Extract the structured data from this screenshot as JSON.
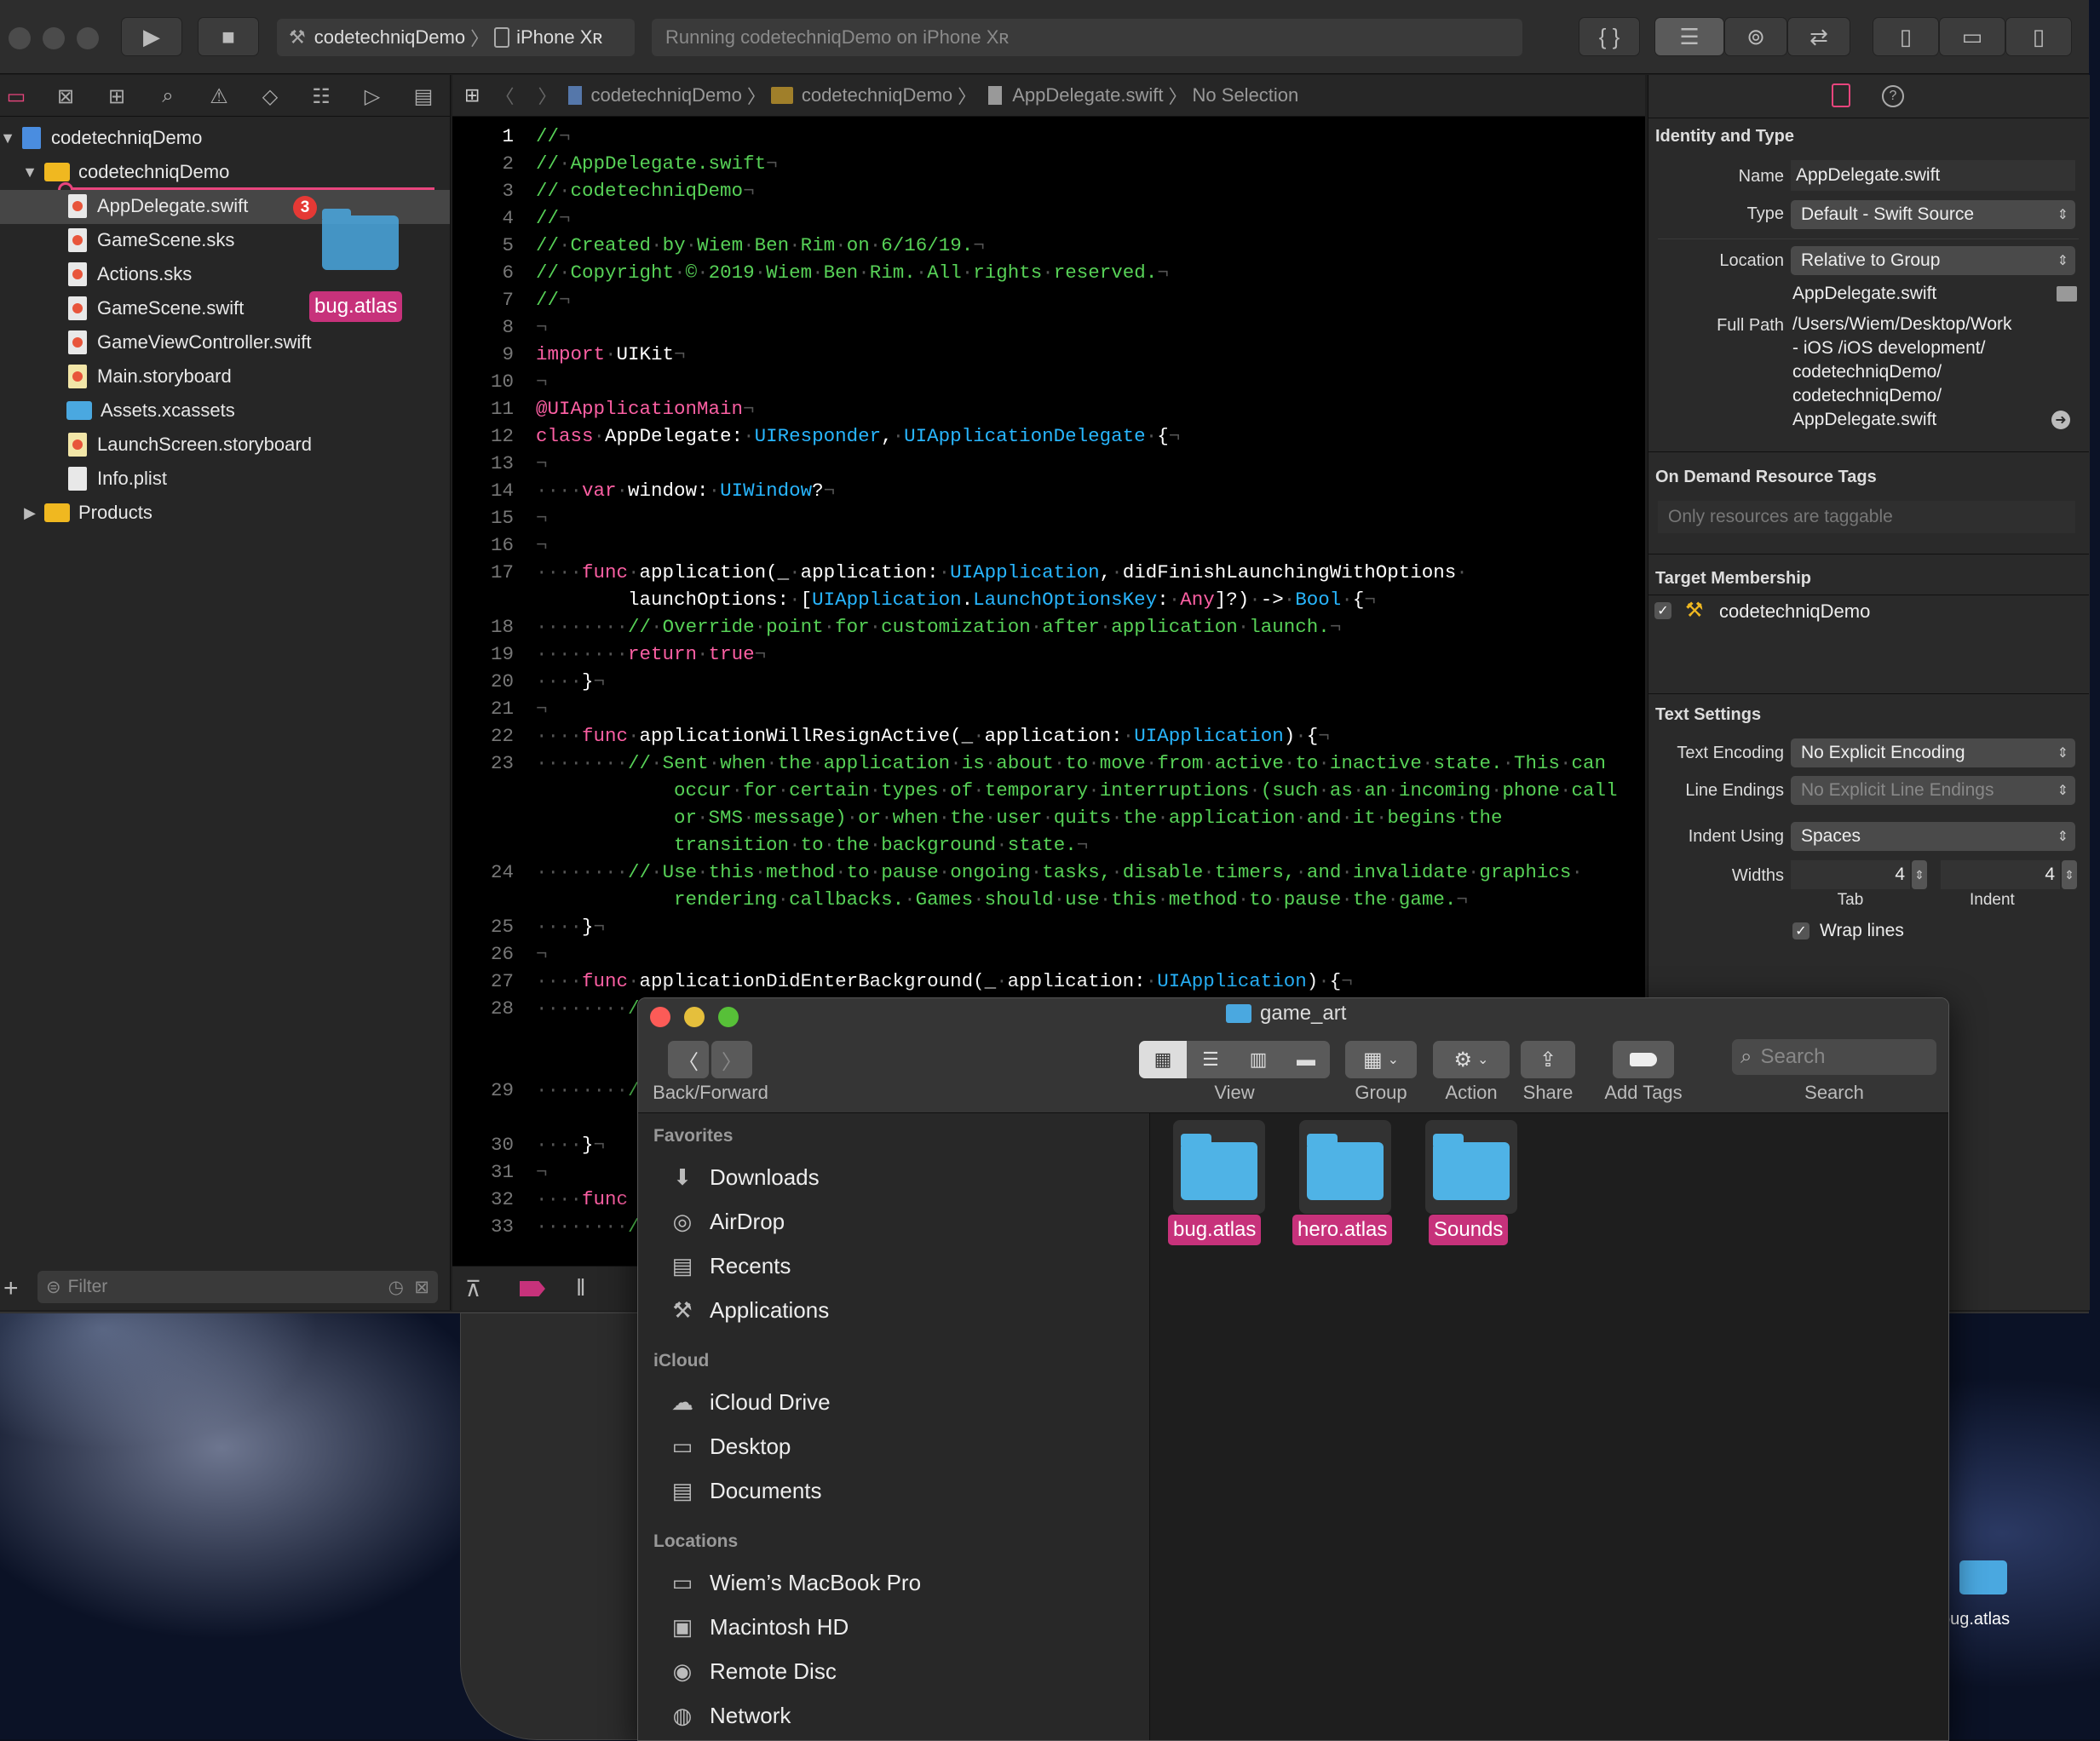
{
  "xcode": {
    "toolbar": {
      "scheme_target": "codetechniqDemo",
      "scheme_device": "iPhone Xʀ",
      "activity": "Running codetechniqDemo on iPhone Xʀ"
    },
    "navigator": {
      "project": "codetechniqDemo",
      "group": "codetechniqDemo",
      "files": [
        "AppDelegate.swift",
        "GameScene.sks",
        "Actions.sks",
        "GameScene.swift",
        "GameViewController.swift",
        "Main.storyboard",
        "Assets.xcassets",
        "LaunchScreen.storyboard",
        "Info.plist"
      ],
      "products": "Products",
      "drop_badge": "3",
      "drag_label": "bug.atlas",
      "filter_placeholder": "Filter"
    },
    "jumpbar": [
      "codetechniqDemo",
      "codetechniqDemo",
      "AppDelegate.swift",
      "No Selection"
    ],
    "code_lines": [
      {
        "n": "1",
        "html": "<span class='c'>//<span class='inv'>¬</span></span>"
      },
      {
        "n": "2",
        "html": "<span class='c'>//<span class='inv'>·</span>AppDelegate.swift<span class='inv'>¬</span></span>"
      },
      {
        "n": "3",
        "html": "<span class='c'>//<span class='inv'>·</span>codetechniqDemo<span class='inv'>¬</span></span>"
      },
      {
        "n": "4",
        "html": "<span class='c'>//<span class='inv'>¬</span></span>"
      },
      {
        "n": "5",
        "html": "<span class='c'>//<span class='inv'>·</span>Created<span class='inv'>·</span>by<span class='inv'>·</span>Wiem<span class='inv'>·</span>Ben<span class='inv'>·</span>Rim<span class='inv'>·</span>on<span class='inv'>·</span>6/16/19.<span class='inv'>¬</span></span>"
      },
      {
        "n": "6",
        "html": "<span class='c'>//<span class='inv'>·</span>Copyright<span class='inv'>·</span>©<span class='inv'>·</span>2019<span class='inv'>·</span>Wiem<span class='inv'>·</span>Ben<span class='inv'>·</span>Rim.<span class='inv'>·</span>All<span class='inv'>·</span>rights<span class='inv'>·</span>reserved.<span class='inv'>¬</span></span>"
      },
      {
        "n": "7",
        "html": "<span class='c'>//<span class='inv'>¬</span></span>"
      },
      {
        "n": "8",
        "html": "<span class='inv'>¬</span>"
      },
      {
        "n": "9",
        "html": "<span class='k'>import</span><span class='inv'>·</span>UIKit<span class='inv'>¬</span>"
      },
      {
        "n": "10",
        "html": "<span class='inv'>¬</span>"
      },
      {
        "n": "11",
        "html": "<span class='k'>@UIApplicationMain</span><span class='inv'>¬</span>"
      },
      {
        "n": "12",
        "html": "<span class='k'>class</span><span class='inv'>·</span>AppDelegate:<span class='inv'>·</span><span class='t'>UIResponder</span>,<span class='inv'>·</span><span class='t'>UIApplicationDelegate</span><span class='inv'>·</span>{<span class='inv'>¬</span>"
      },
      {
        "n": "13",
        "html": "<span class='inv'>¬</span>"
      },
      {
        "n": "14",
        "html": "<span class='inv'>····</span><span class='k'>var</span><span class='inv'>·</span>window:<span class='inv'>·</span><span class='t'>UIWindow</span>?<span class='inv'>¬</span>"
      },
      {
        "n": "15",
        "html": "<span class='inv'>¬</span>"
      },
      {
        "n": "16",
        "html": "<span class='inv'>¬</span>"
      },
      {
        "n": "17",
        "html": "<span class='inv'>····</span><span class='k'>func</span><span class='inv'>·</span>application(_<span class='inv'>·</span>application:<span class='inv'>·</span><span class='t'>UIApplication</span>,<span class='inv'>·</span>didFinishLaunchingWithOptions<span class='inv'>·</span>"
      },
      {
        "n": "",
        "html": "<span class='inv'>    </span>    launchOptions:<span class='inv'>·</span>[<span class='t'>UIApplication</span>.<span class='t'>LaunchOptionsKey</span>:<span class='inv'>·</span><span class='k'>Any</span>]?)<span class='inv'>·</span>-><span class='inv'>·</span><span class='t'>Bool</span><span class='inv'>·</span>{<span class='inv'>¬</span>"
      },
      {
        "n": "18",
        "html": "<span class='inv'>········</span><span class='c'>//<span class='inv'>·</span>Override<span class='inv'>·</span>point<span class='inv'>·</span>for<span class='inv'>·</span>customization<span class='inv'>·</span>after<span class='inv'>·</span>application<span class='inv'>·</span>launch.<span class='inv'>¬</span></span>"
      },
      {
        "n": "19",
        "html": "<span class='inv'>········</span><span class='k'>return</span><span class='inv'>·</span><span class='k'>true</span><span class='inv'>¬</span>"
      },
      {
        "n": "20",
        "html": "<span class='inv'>····</span>}<span class='inv'>¬</span>"
      },
      {
        "n": "21",
        "html": "<span class='inv'>¬</span>"
      },
      {
        "n": "22",
        "html": "<span class='inv'>····</span><span class='k'>func</span><span class='inv'>·</span>applicationWillResignActive(_<span class='inv'>·</span>application:<span class='inv'>·</span><span class='t'>UIApplication</span>)<span class='inv'>·</span>{<span class='inv'>¬</span>"
      },
      {
        "n": "23",
        "html": "<span class='inv'>········</span><span class='c'>//<span class='inv'>·</span>Sent<span class='inv'>·</span>when<span class='inv'>·</span>the<span class='inv'>·</span>application<span class='inv'>·</span>is<span class='inv'>·</span>about<span class='inv'>·</span>to<span class='inv'>·</span>move<span class='inv'>·</span>from<span class='inv'>·</span>active<span class='inv'>·</span>to<span class='inv'>·</span>inactive<span class='inv'>·</span>state.<span class='inv'>·</span>This<span class='inv'>·</span>can</span>"
      },
      {
        "n": "",
        "html": "<span class='c'>            occur<span class='inv'>·</span>for<span class='inv'>·</span>certain<span class='inv'>·</span>types<span class='inv'>·</span>of<span class='inv'>·</span>temporary<span class='inv'>·</span>interruptions<span class='inv'>·</span>(such<span class='inv'>·</span>as<span class='inv'>·</span>an<span class='inv'>·</span>incoming<span class='inv'>·</span>phone<span class='inv'>·</span>call</span>"
      },
      {
        "n": "",
        "html": "<span class='c'>            or<span class='inv'>·</span>SMS<span class='inv'>·</span>message)<span class='inv'>·</span>or<span class='inv'>·</span>when<span class='inv'>·</span>the<span class='inv'>·</span>user<span class='inv'>·</span>quits<span class='inv'>·</span>the<span class='inv'>·</span>application<span class='inv'>·</span>and<span class='inv'>·</span>it<span class='inv'>·</span>begins<span class='inv'>·</span>the</span>"
      },
      {
        "n": "",
        "html": "<span class='c'>            transition<span class='inv'>·</span>to<span class='inv'>·</span>the<span class='inv'>·</span>background<span class='inv'>·</span>state.<span class='inv'>¬</span></span>"
      },
      {
        "n": "24",
        "html": "<span class='inv'>········</span><span class='c'>//<span class='inv'>·</span>Use<span class='inv'>·</span>this<span class='inv'>·</span>method<span class='inv'>·</span>to<span class='inv'>·</span>pause<span class='inv'>·</span>ongoing<span class='inv'>·</span>tasks,<span class='inv'>·</span>disable<span class='inv'>·</span>timers,<span class='inv'>·</span>and<span class='inv'>·</span>invalidate<span class='inv'>·</span>graphics<span class='inv'>·</span></span>"
      },
      {
        "n": "",
        "html": "<span class='c'>            rendering<span class='inv'>·</span>callbacks.<span class='inv'>·</span>Games<span class='inv'>·</span>should<span class='inv'>·</span>use<span class='inv'>·</span>this<span class='inv'>·</span>method<span class='inv'>·</span>to<span class='inv'>·</span>pause<span class='inv'>·</span>the<span class='inv'>·</span>game.<span class='inv'>¬</span></span>"
      },
      {
        "n": "25",
        "html": "<span class='inv'>····</span>}<span class='inv'>¬</span>"
      },
      {
        "n": "26",
        "html": "<span class='inv'>¬</span>"
      },
      {
        "n": "27",
        "html": "<span class='inv'>····</span><span class='k'>func</span><span class='inv'>·</span>applicationDidEnterBackground(_<span class='inv'>·</span>application:<span class='inv'>·</span><span class='t'>UIApplication</span>)<span class='inv'>·</span>{<span class='inv'>¬</span>"
      },
      {
        "n": "28",
        "html": "<span class='inv'>········</span><span class='c'>/</span>"
      },
      {
        "n": "",
        "html": ""
      },
      {
        "n": "",
        "html": ""
      },
      {
        "n": "29",
        "html": "<span class='inv'>········</span><span class='c'>/</span>"
      },
      {
        "n": "",
        "html": ""
      },
      {
        "n": "30",
        "html": "<span class='inv'>····</span>}<span class='inv'>¬</span>"
      },
      {
        "n": "31",
        "html": "<span class='inv'>¬</span>"
      },
      {
        "n": "32",
        "html": "<span class='inv'>····</span><span class='k'>func</span>"
      },
      {
        "n": "33",
        "html": "<span class='inv'>········</span><span class='c'>/</span>"
      }
    ],
    "inspector": {
      "identity_title": "Identity and Type",
      "name_label": "Name",
      "name_value": "AppDelegate.swift",
      "type_label": "Type",
      "type_value": "Default - Swift Source",
      "location_label": "Location",
      "location_value": "Relative to Group",
      "location_file": "AppDelegate.swift",
      "fullpath_label": "Full Path",
      "fullpath_lines": [
        "/Users/Wiem/Desktop/Work",
        "- iOS /iOS development/",
        "codetechniqDemo/",
        "codetechniqDemo/",
        "AppDelegate.swift"
      ],
      "odr_title": "On Demand Resource Tags",
      "odr_placeholder": "Only resources are taggable",
      "target_title": "Target Membership",
      "target_name": "codetechniqDemo",
      "text_title": "Text Settings",
      "encoding_label": "Text Encoding",
      "encoding_value": "No Explicit Encoding",
      "endings_label": "Line Endings",
      "endings_value": "No Explicit Line Endings",
      "indent_label": "Indent Using",
      "indent_value": "Spaces",
      "widths_label": "Widths",
      "tab_value": "4",
      "indent_width_value": "4",
      "tab_label": "Tab",
      "indent_label2": "Indent",
      "wrap_label": "Wrap lines"
    }
  },
  "finder": {
    "title": "game_art",
    "toolbar": {
      "back_forward": "Back/Forward",
      "view": "View",
      "group": "Group",
      "action": "Action",
      "share": "Share",
      "add_tags": "Add Tags",
      "search_placeholder": "Search",
      "search_label": "Search"
    },
    "sidebar": {
      "favorites_title": "Favorites",
      "favorites": [
        {
          "label": "Downloads",
          "icon": "download-icon"
        },
        {
          "label": "AirDrop",
          "icon": "airdrop-icon"
        },
        {
          "label": "Recents",
          "icon": "recents-icon"
        },
        {
          "label": "Applications",
          "icon": "applications-icon"
        }
      ],
      "icloud_title": "iCloud",
      "icloud": [
        {
          "label": "iCloud Drive",
          "icon": "cloud-icon"
        },
        {
          "label": "Desktop",
          "icon": "desktop-icon"
        },
        {
          "label": "Documents",
          "icon": "documents-icon"
        }
      ],
      "locations_title": "Locations",
      "locations": [
        {
          "label": "Wiem’s MacBook Pro",
          "icon": "laptop-icon"
        },
        {
          "label": "Macintosh HD",
          "icon": "disk-icon"
        },
        {
          "label": "Remote Disc",
          "icon": "disc-icon"
        },
        {
          "label": "Network",
          "icon": "network-icon"
        }
      ]
    },
    "items": [
      "bug.atlas",
      "hero.atlas",
      "Sounds"
    ],
    "tag_color": "#c7327b"
  },
  "desktop": {
    "item_label": "bug.atlas"
  }
}
